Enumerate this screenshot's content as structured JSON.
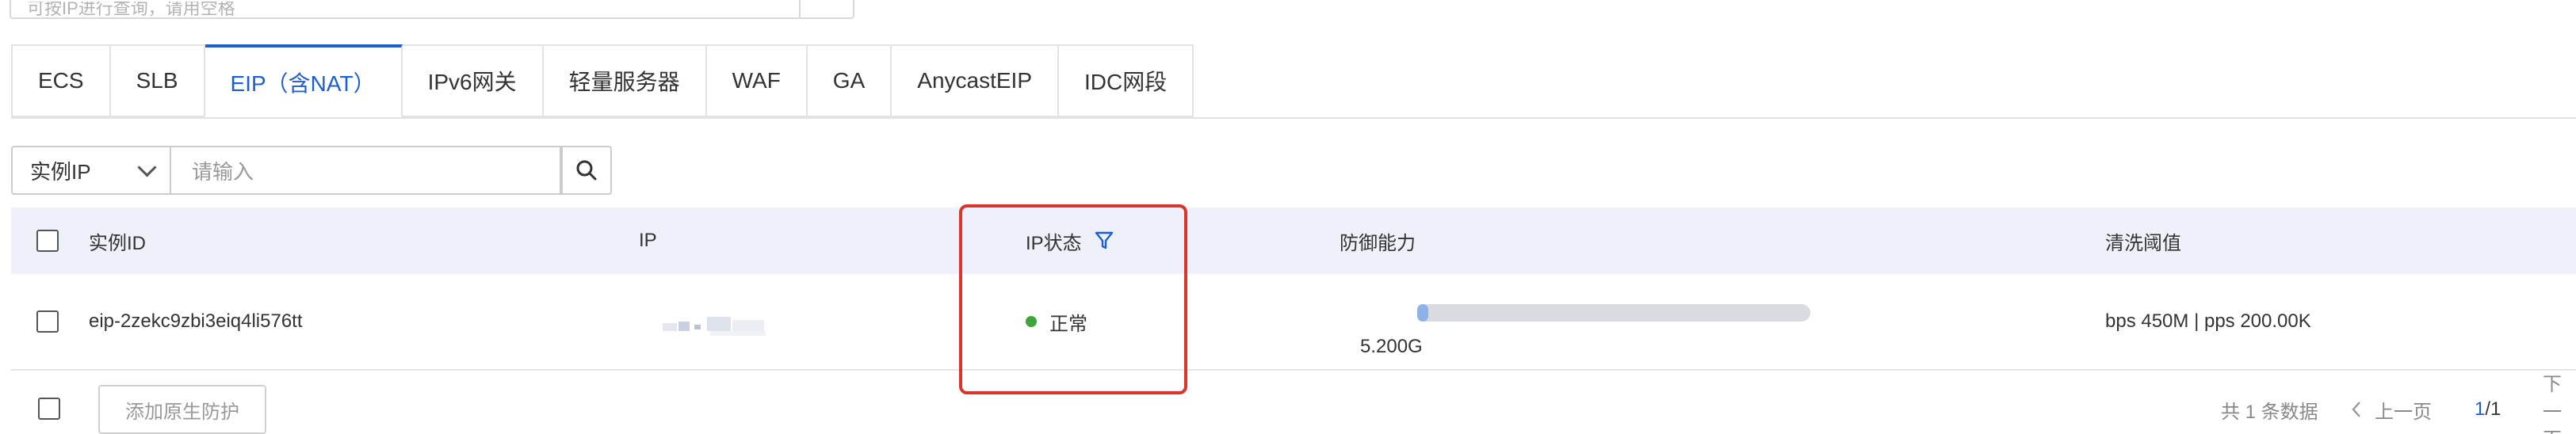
{
  "top_search": {
    "placeholder": "可按IP进行查询，请用空格"
  },
  "tabs": [
    {
      "label": "ECS",
      "active": false
    },
    {
      "label": "SLB",
      "active": false
    },
    {
      "label": "EIP（含NAT）",
      "active": true
    },
    {
      "label": "IPv6网关",
      "active": false
    },
    {
      "label": "轻量服务器",
      "active": false
    },
    {
      "label": "WAF",
      "active": false
    },
    {
      "label": "GA",
      "active": false
    },
    {
      "label": "AnycastEIP",
      "active": false
    },
    {
      "label": "IDC网段",
      "active": false
    }
  ],
  "filter": {
    "select_value": "实例IP",
    "input_placeholder": "请输入",
    "search_icon": "search-icon"
  },
  "table": {
    "headers": {
      "instance_id": "实例ID",
      "ip": "IP",
      "ip_status": "IP状态",
      "defense": "防御能力",
      "threshold": "清洗阈值"
    },
    "rows": [
      {
        "instance_id": "eip-2zekc9zbi3eiq4li576tt",
        "ip": "",
        "status": "正常",
        "defense_value": "5.200G",
        "defense_fill": 0.015,
        "threshold": "bps 450M | pps 200.00K"
      }
    ]
  },
  "footer": {
    "button": "添加原生防护",
    "total": "共 1 条数据",
    "prev": "上一页",
    "page_current": "1",
    "page_total": "/1",
    "next": "下一页"
  },
  "colors": {
    "accent": "#1f5fcc",
    "status_ok": "#3fa53b",
    "highlight": "#d9362b",
    "header_bg": "#eef1f9"
  }
}
